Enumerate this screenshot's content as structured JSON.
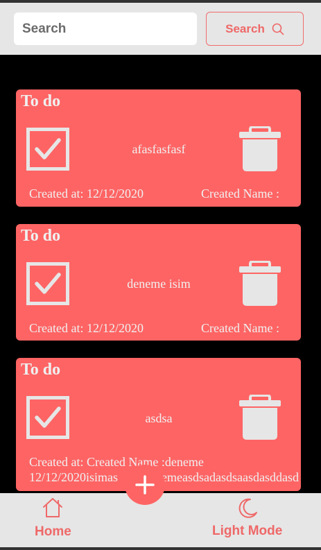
{
  "header": {
    "search_placeholder": "Search",
    "search_button_label": "Search"
  },
  "todos": [
    {
      "title": "To do",
      "text": "afasfasfasf",
      "created_at": "Created at: 12/12/2020",
      "created_name": "Created Name :"
    },
    {
      "title": "To do",
      "text": "deneme isim",
      "created_at": "Created at: 12/12/2020",
      "created_name": "Created Name :"
    },
    {
      "title": "To do",
      "text": "asdsa",
      "created_at_line1": "Created at: Created Name :deneme",
      "created_at_line2": "12/12/2020isimas",
      "created_at_line2b": "enemeasdsadasdsaasdasddasd"
    }
  ],
  "nav": {
    "home_label": "Home",
    "theme_label": "Light Mode"
  },
  "colors": {
    "accent": "#fe6464",
    "header_bg": "#e6e6e6",
    "background": "#000000",
    "icon_fill": "#e6e6e6"
  },
  "icons": {
    "search": "search-icon",
    "check": "checkbox-checked-icon",
    "trash": "trash-icon",
    "home": "home-icon",
    "moon": "moon-icon",
    "add": "plus-icon"
  }
}
